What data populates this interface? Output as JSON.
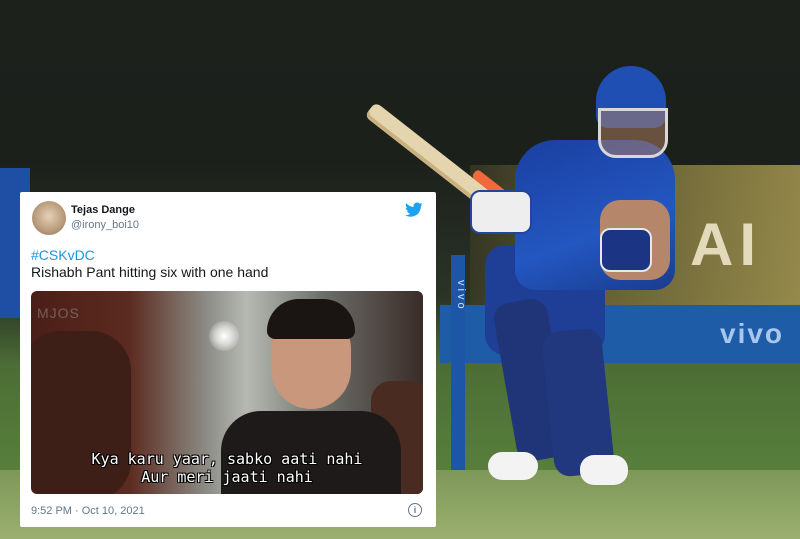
{
  "tweet": {
    "author_name": "Tejas Dange",
    "author_handle": "@irony_boi10",
    "hashtag": "#CSKvDC",
    "text": "Rishabh Pant hitting six with one hand",
    "media": {
      "watermark": "MJOS",
      "subtitle_line1": "Kya karu yaar, sabko aati nahi",
      "subtitle_line2": "Aur meri jaati nahi"
    },
    "timestamp": "9:52 PM · Oct 10, 2021"
  },
  "background_photo": {
    "signage_text": "vivo",
    "board_text": "AI"
  },
  "colors": {
    "twitter_blue": "#1da1f2",
    "link_blue": "#1b95e0",
    "jersey_blue": "#1f4fb3"
  }
}
